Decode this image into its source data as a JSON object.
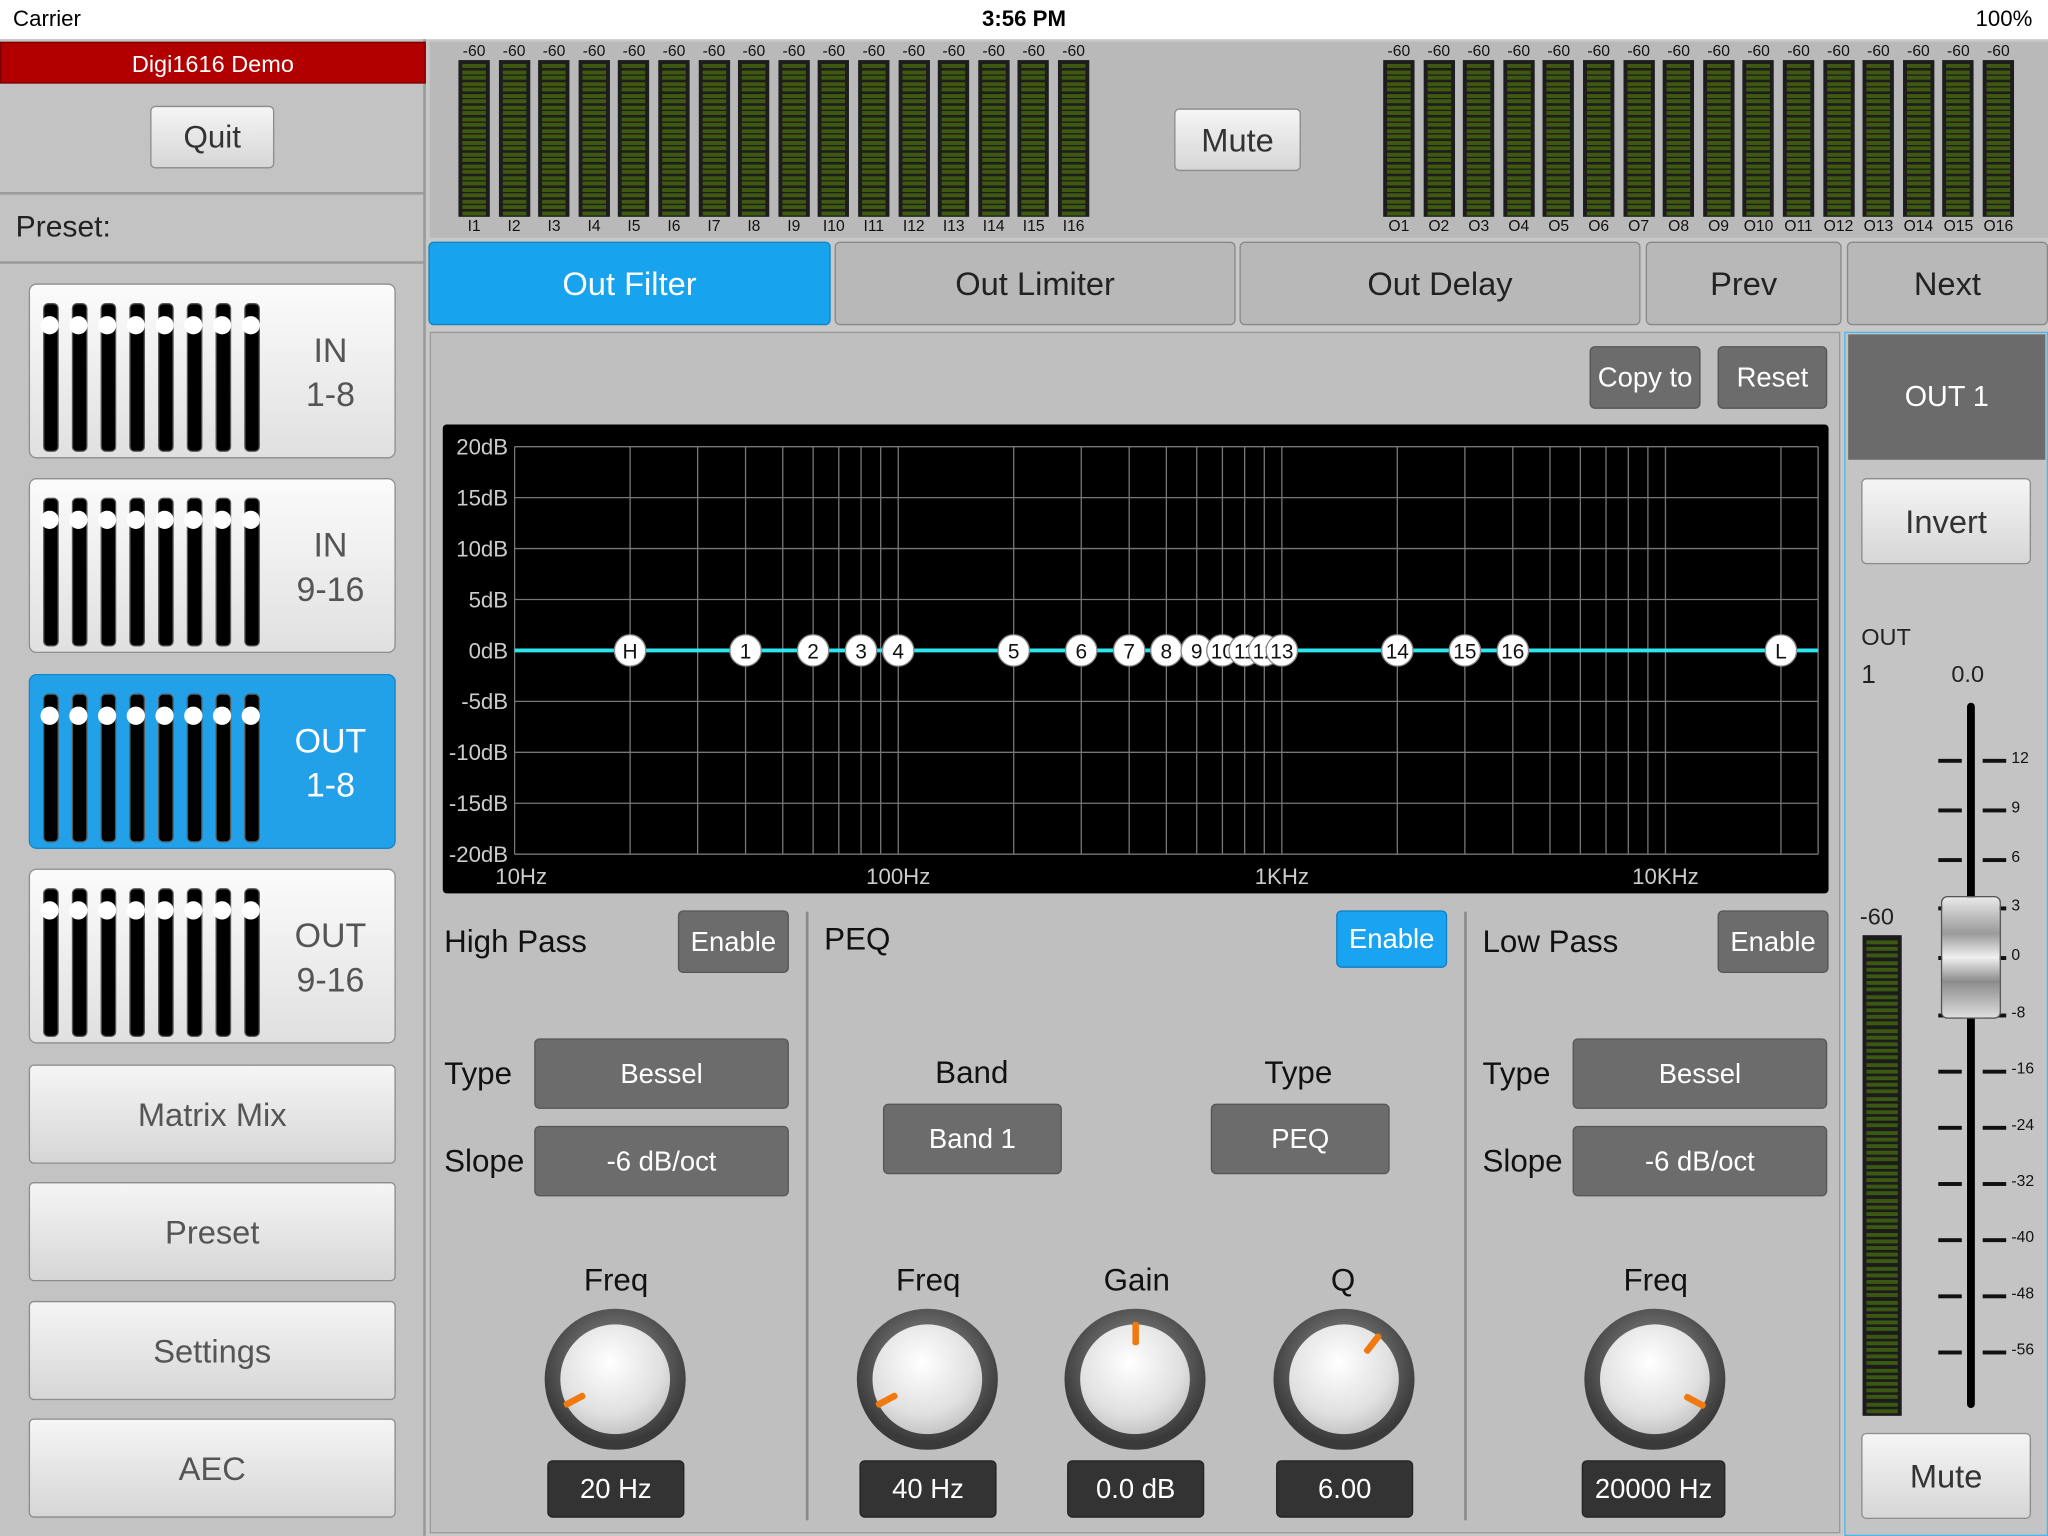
{
  "status": {
    "carrier": "Carrier",
    "time": "3:56 PM",
    "battery": "100%"
  },
  "app": {
    "title": "Digi1616 Demo",
    "quit": "Quit",
    "preset_label": "Preset:"
  },
  "tiles": [
    {
      "line1": "IN",
      "line2": "1-8",
      "active": false,
      "level": 0.91
    },
    {
      "line1": "IN",
      "line2": "9-16",
      "active": false,
      "level": 0.91
    },
    {
      "line1": "OUT",
      "line2": "1-8",
      "active": true,
      "level": 0.91
    },
    {
      "line1": "OUT",
      "line2": "9-16",
      "active": false,
      "level": 0.91
    }
  ],
  "menu": {
    "matrix": "Matrix Mix",
    "preset": "Preset",
    "settings": "Settings",
    "aec": "AEC"
  },
  "meters": {
    "value": "-60",
    "inputs": [
      "I1",
      "I2",
      "I3",
      "I4",
      "I5",
      "I6",
      "I7",
      "I8",
      "I9",
      "I10",
      "I11",
      "I12",
      "I13",
      "I14",
      "I15",
      "I16"
    ],
    "outputs": [
      "O1",
      "O2",
      "O3",
      "O4",
      "O5",
      "O6",
      "O7",
      "O8",
      "O9",
      "O10",
      "O11",
      "O12",
      "O13",
      "O14",
      "O15",
      "O16"
    ],
    "mute": "Mute"
  },
  "tabs": {
    "out_filter": "Out Filter",
    "out_limiter": "Out Limiter",
    "out_delay": "Out Delay",
    "prev": "Prev",
    "next": "Next"
  },
  "actions": {
    "copy_to": "Copy to",
    "reset": "Reset"
  },
  "graph": {
    "ylabels": [
      "20dB",
      "15dB",
      "10dB",
      "5dB",
      "0dB",
      "-5dB",
      "-10dB",
      "-15dB",
      "-20dB"
    ],
    "xlabels": [
      "10Hz",
      "100Hz",
      "1KHz",
      "10KHz"
    ],
    "colors": {
      "curve": "#2ee6f0",
      "grid": "#777777",
      "background": "#000000"
    },
    "points": [
      {
        "label": "H",
        "hz": 20
      },
      {
        "label": "1",
        "hz": 40
      },
      {
        "label": "2",
        "hz": 60
      },
      {
        "label": "3",
        "hz": 80
      },
      {
        "label": "4",
        "hz": 100
      },
      {
        "label": "5",
        "hz": 200
      },
      {
        "label": "6",
        "hz": 300
      },
      {
        "label": "7",
        "hz": 400
      },
      {
        "label": "8",
        "hz": 500
      },
      {
        "label": "9",
        "hz": 600
      },
      {
        "label": "10",
        "hz": 700
      },
      {
        "label": "11",
        "hz": 800
      },
      {
        "label": "12",
        "hz": 900
      },
      {
        "label": "13",
        "hz": 1000
      },
      {
        "label": "14",
        "hz": 2000
      },
      {
        "label": "15",
        "hz": 3000
      },
      {
        "label": "16",
        "hz": 4000
      },
      {
        "label": "L",
        "hz": 20000
      }
    ]
  },
  "highpass": {
    "title": "High Pass",
    "enable": "Enable",
    "type_label": "Type",
    "type": "Bessel",
    "slope_label": "Slope",
    "slope": "-6 dB/oct",
    "freq_label": "Freq",
    "freq": "20 Hz"
  },
  "peq": {
    "title": "PEQ",
    "enable": "Enable",
    "band_label": "Band",
    "band": "Band 1",
    "type_label": "Type",
    "type": "PEQ",
    "freq_label": "Freq",
    "freq": "40 Hz",
    "gain_label": "Gain",
    "gain": "0.0 dB",
    "q_label": "Q",
    "q": "6.00"
  },
  "lowpass": {
    "title": "Low Pass",
    "enable": "Enable",
    "type_label": "Type",
    "type": "Bessel",
    "slope_label": "Slope",
    "slope": "-6 dB/oct",
    "freq_label": "Freq",
    "freq": "20000 Hz"
  },
  "channel": {
    "name": "OUT 1",
    "invert": "Invert",
    "out_label": "OUT",
    "out_num": "1",
    "gain_value": "0.0",
    "meter_value": "-60",
    "scale": [
      "12",
      "9",
      "6",
      "3",
      "0",
      "-8",
      "-16",
      "-24",
      "-32",
      "-40",
      "-48",
      "-56"
    ],
    "mute": "Mute"
  }
}
